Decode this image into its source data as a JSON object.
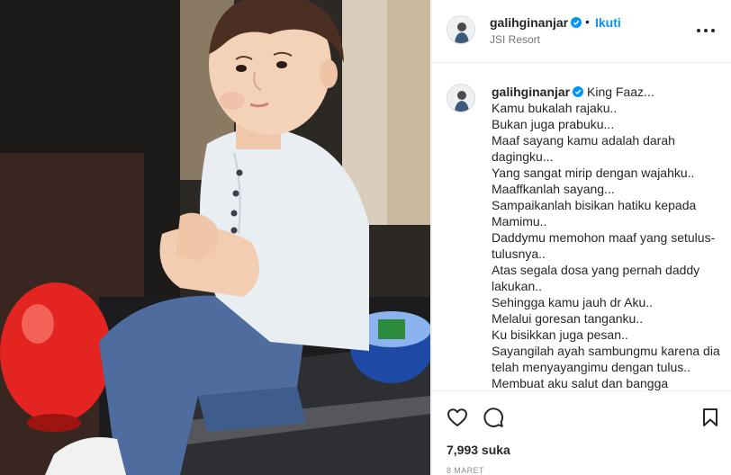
{
  "post": {
    "image_alt": "Photo of a young boy sitting on a bench",
    "username": "galihginanjar",
    "verified": true,
    "follow_label": "Ikuti",
    "separator": "•",
    "location": "JSI Resort",
    "more_icon": "more-horizontal-icon",
    "caption": {
      "username": "galihginanjar",
      "first_line": "King Faaz...",
      "lines": [
        "Kamu bukalah rajaku..",
        "Bukan juga prabuku...",
        "Maaf sayang kamu adalah darah",
        "dagingku...",
        "Yang sangat mirip dengan wajahku..",
        "Maaffkanlah sayang...",
        "Sampaikanlah bisikan hatiku kepada",
        "Mamimu..",
        "Daddymu memohon maaf yang setulus-",
        "tulusnya..",
        "Atas segala dosa yang pernah daddy",
        "lakukan..",
        "Sehingga kamu jauh dr Aku..",
        "Melalui goresan tanganku..",
        "Ku bisikkan juga pesan..",
        "Sayangilah ayah sambungmu karena dia",
        "telah menyayangimu dengan tulus..",
        "Membuat aku salut dan bangga"
      ]
    },
    "likes": "7,993 suka",
    "date": "8 MARET"
  },
  "icons": {
    "like": "heart-outline-icon",
    "comment": "comment-bubble-icon",
    "save": "bookmark-icon",
    "verified": "verified-badge-icon"
  },
  "colors": {
    "accent": "#0095f6",
    "text": "#262626",
    "muted": "#737373",
    "border": "#efefef"
  }
}
